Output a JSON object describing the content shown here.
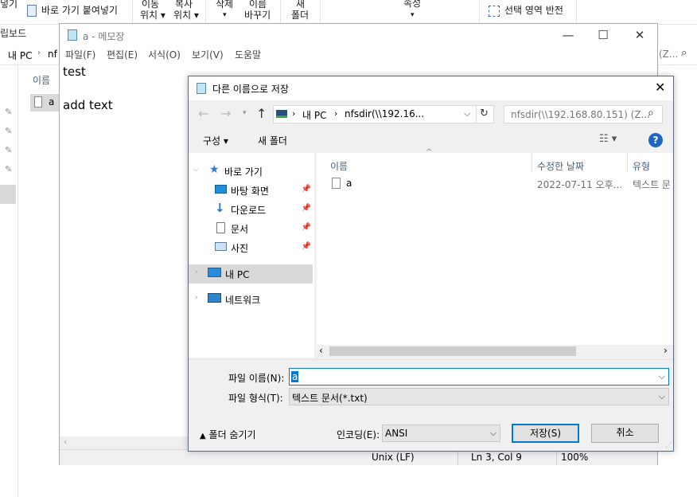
{
  "explorer": {
    "ribbon": {
      "paste_partial": "넣기",
      "paste_shortcut": "바로 가기 붙여넣기",
      "move_to_top": "이동",
      "move_to_bottom": "위치",
      "copy_to_top": "복사",
      "copy_to_bottom": "위치",
      "delete": "삭제",
      "rename_top": "이름",
      "rename_bottom": "바꾸기",
      "new_folder_top": "새",
      "new_folder_bottom": "폴더",
      "properties": "속성",
      "invert_selection": "선택 영역 반전",
      "clipboard": "립보드"
    },
    "address": {
      "crumb_pc": "내 PC",
      "crumb_nfs_partial": "nf"
    },
    "search_partial": "(Z...",
    "column_name": "이름",
    "file_a": "a"
  },
  "notepad": {
    "title": "a - 메모장",
    "menu": [
      "파일(F)",
      "편집(E)",
      "서식(O)",
      "보기(V)",
      "도움말"
    ],
    "text_line1": "test",
    "text_line3": "add text",
    "status": {
      "eol": "Unix (LF)",
      "position": "Ln 3, Col 9",
      "zoom": "100%"
    }
  },
  "dialog": {
    "title": "다른 이름으로 저장",
    "address": {
      "pc": "내 PC",
      "nfs": "nfsdir(\\\\192.16..."
    },
    "search_placeholder": "nfsdir(\\\\192.168.80.151) (Z...",
    "toolbar": {
      "organize": "구성",
      "new_folder": "새 폴더"
    },
    "nav": {
      "quick_access": "바로 가기",
      "desktop": "바탕 화면",
      "downloads": "다운로드",
      "documents": "문서",
      "pictures": "사진",
      "this_pc": "내 PC",
      "network": "네트워크"
    },
    "columns": {
      "name": "이름",
      "date": "수정한 날짜",
      "type": "유형"
    },
    "files": [
      {
        "name": "a",
        "date": "2022-07-11 오후...",
        "type": "텍스트 문"
      }
    ],
    "filename_label": "파일 이름(N):",
    "filename_value": "a",
    "filetype_label": "파일 형식(T):",
    "filetype_value": "텍스트 문서(*.txt)",
    "hide_folders": "폴더 숨기기",
    "encoding_label": "인코딩(E):",
    "encoding_value": "ANSI",
    "save_button": "저장(S)",
    "cancel_button": "취소"
  },
  "colors": {
    "accent": "#0078d7",
    "selection": "#cce8ff",
    "nav_selected": "#d9d9d9",
    "help": "#1f66c1"
  }
}
